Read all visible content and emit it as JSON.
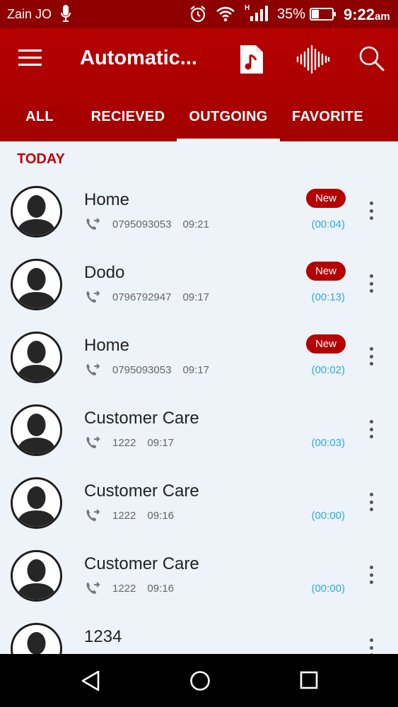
{
  "status_bar": {
    "carrier": "Zain JO",
    "network_type": "H",
    "battery_percent": "35%",
    "time": "9:22",
    "time_suffix": "am"
  },
  "app_bar": {
    "title": "Automatic...",
    "actions": [
      "file-music-icon",
      "audio-wave-icon",
      "search-icon"
    ]
  },
  "tabs": [
    {
      "label": "ALL",
      "active": false
    },
    {
      "label": "RECIEVED",
      "active": false
    },
    {
      "label": "OUTGOING",
      "active": true
    },
    {
      "label": "FAVORITE",
      "active": false
    }
  ],
  "section_header": "TODAY",
  "calls": [
    {
      "name": "Home",
      "number": "0795093053",
      "time": "09:21",
      "duration": "(00:04)",
      "badge": "New"
    },
    {
      "name": "Dodo",
      "number": "0796792947",
      "time": "09:17",
      "duration": "(00:13)",
      "badge": "New"
    },
    {
      "name": "Home",
      "number": "0795093053",
      "time": "09:17",
      "duration": "(00:02)",
      "badge": "New"
    },
    {
      "name": "Customer Care",
      "number": "1222",
      "time": "09:17",
      "duration": "(00:03)",
      "badge": ""
    },
    {
      "name": "Customer Care",
      "number": "1222",
      "time": "09:16",
      "duration": "(00:00)",
      "badge": ""
    },
    {
      "name": "Customer Care",
      "number": "1222",
      "time": "09:16",
      "duration": "(00:00)",
      "badge": ""
    },
    {
      "name": "1234",
      "number": "",
      "time": "",
      "duration": "",
      "badge": ""
    }
  ],
  "colors": {
    "status_bar": "#8e0000",
    "app_bar": "#b60000",
    "accent_red": "#c00000",
    "duration_blue": "#2aaed6",
    "list_background": "#eef2f9"
  }
}
